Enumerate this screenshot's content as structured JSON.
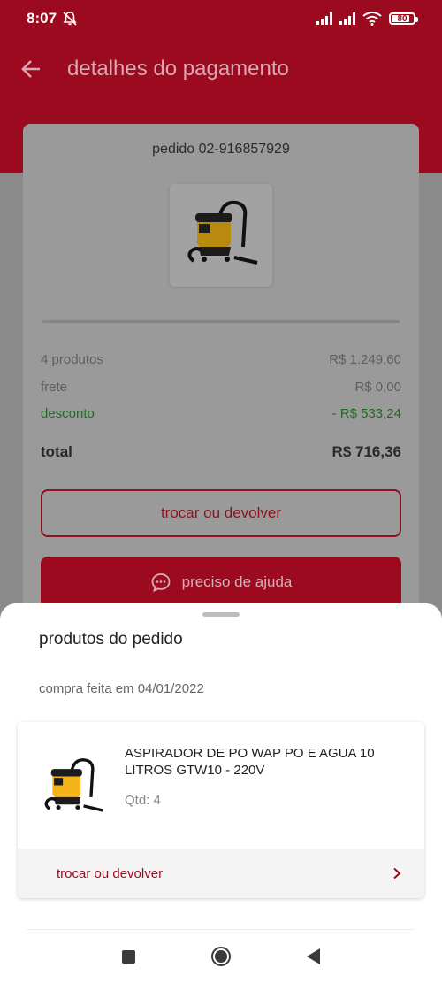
{
  "status": {
    "time": "8:07",
    "battery": "80"
  },
  "header": {
    "title": "detalhes do pagamento"
  },
  "order": {
    "id_label": "pedido 02-916857929",
    "summary": [
      {
        "label": "4 produtos",
        "value": "R$ 1.249,60"
      },
      {
        "label": "frete",
        "value": "R$ 0,00"
      },
      {
        "label": "desconto",
        "value": "- R$ 533,24"
      },
      {
        "label": "total",
        "value": "R$ 716,36"
      }
    ],
    "exchange_button": "trocar ou devolver",
    "help_button": "preciso de ajuda"
  },
  "sheet": {
    "title": "produtos do pedido",
    "purchase_date": "compra feita em 04/01/2022",
    "product": {
      "name": "ASPIRADOR DE PO WAP PO E AGUA 10 LITROS GTW10 - 220V",
      "qty": "Qtd: 4",
      "action": "trocar ou devolver"
    }
  },
  "colors": {
    "brand": "#9c0a1f",
    "discount": "#2e8b2e"
  },
  "icons": {
    "back": "arrow-left-icon",
    "help": "chat-bubble-icon",
    "chevron": "chevron-right-icon"
  }
}
